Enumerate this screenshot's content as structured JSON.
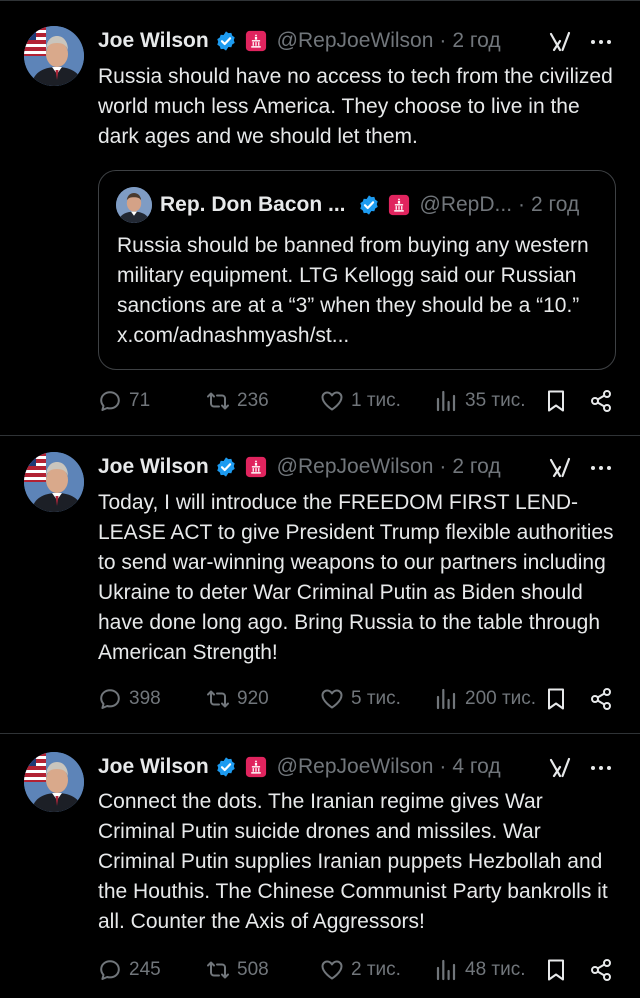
{
  "tweets": [
    {
      "name": "Joe Wilson",
      "handle": "@RepJoeWilson",
      "time": "2 год",
      "text": "Russia should have no access to tech from the civilized world much less America. They choose to live in the dark ages and we should let them.",
      "quote": {
        "name": "Rep. Don Bacon ...",
        "handle": "@RepD...",
        "time": "2 год",
        "text": "Russia should be banned from buying any western military equipment. LTG Kellogg said our Russian sanctions are at a “3” when they should be a “10.” x.com/adnashmyash/st..."
      },
      "replies": "71",
      "reposts": "236",
      "likes": "1 тис.",
      "views": "35 тис."
    },
    {
      "name": "Joe Wilson",
      "handle": "@RepJoeWilson",
      "time": "2 год",
      "text": "Today, I will introduce the FREEDOM FIRST LEND-LEASE ACT to give President Trump flexible authorities to send war-winning weapons to our partners including Ukraine to deter War Criminal Putin as Biden should have done long ago. Bring Russia to the table through American Strength!",
      "replies": "398",
      "reposts": "920",
      "likes": "5 тис.",
      "views": "200 тис."
    },
    {
      "name": "Joe Wilson",
      "handle": "@RepJoeWilson",
      "time": "4 год",
      "text": "Connect the dots. The Iranian regime gives War Criminal Putin suicide drones and missiles. War Criminal Putin supplies Iranian puppets Hezbollah and the Houthis. The Chinese Communist Party bankrolls it all. Counter the Axis of Aggressors!",
      "replies": "245",
      "reposts": "508",
      "likes": "2 тис.",
      "views": "48 тис."
    }
  ],
  "separator": "·",
  "colors": {
    "verified": "#1d9bf0",
    "muted": "#71767b",
    "text": "#e7e9ea",
    "gov_badge": "#e0245e"
  },
  "icons": [
    "verified-badge-icon",
    "government-badge-icon",
    "grok-icon",
    "more-icon",
    "reply-icon",
    "repost-icon",
    "like-icon",
    "views-icon",
    "bookmark-icon",
    "share-icon"
  ]
}
